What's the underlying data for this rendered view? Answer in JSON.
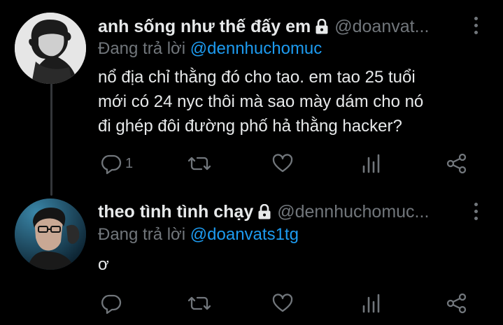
{
  "tweets": [
    {
      "display_name": "anh sống như thế đấy em",
      "handle": "@doanvat...",
      "reply_prefix": "Đang trả lời ",
      "reply_to": "@dennhuchomuc",
      "text": "nổ địa chỉ thằng đó cho tao. em tao 25 tuổi\nmới có 24 nyc thôi mà sao mày dám cho nó\nđi ghép đôi đường phố hả thằng hacker?",
      "reply_count": "1",
      "icons": [
        "lock-icon",
        "more-icon",
        "reply-icon",
        "retweet-icon",
        "like-icon",
        "analytics-icon",
        "share-icon"
      ]
    },
    {
      "display_name": "theo tình tình chạy",
      "handle": "@dennhuchomuc...",
      "reply_prefix": "Đang trả lời ",
      "reply_to": "@doanvats1tg",
      "text": "ơ",
      "reply_count": "",
      "icons": [
        "lock-icon",
        "more-icon",
        "reply-icon",
        "retweet-icon",
        "like-icon",
        "analytics-icon",
        "share-icon"
      ]
    }
  ],
  "colors": {
    "background": "#000000",
    "text": "#e7e9ea",
    "muted": "#71767b",
    "link": "#1d9bf0"
  }
}
